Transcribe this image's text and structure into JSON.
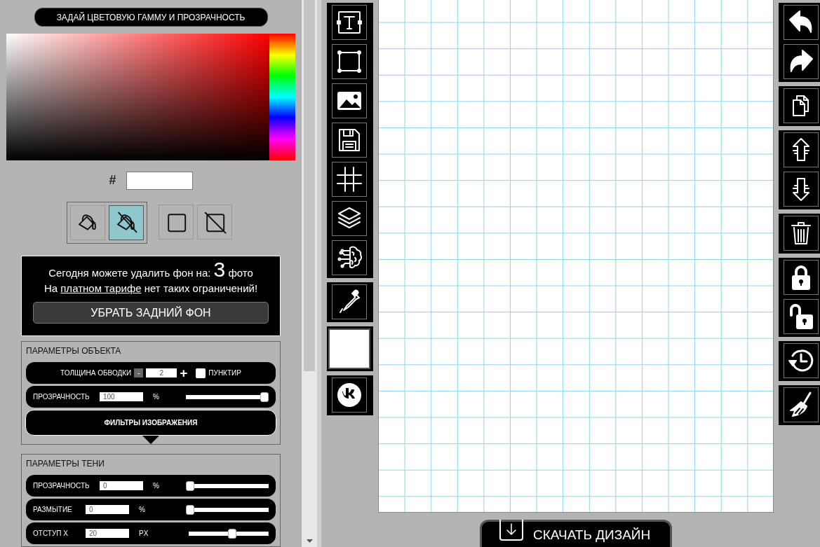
{
  "color_panel": {
    "title": "ЗАДАЙ ЦВЕТОВУЮ ГАММУ И ПРОЗРАЧНОСТЬ",
    "hex_label": "#",
    "fill_buttons": [
      {
        "kind": "fill",
        "selected": false
      },
      {
        "kind": "no-fill",
        "selected": true
      }
    ],
    "stroke_buttons": [
      {
        "kind": "stroke",
        "selected": false
      },
      {
        "kind": "no-stroke",
        "selected": false
      }
    ]
  },
  "promo": {
    "line1_before": "Сегодня можете удалить фон на:",
    "count": "3",
    "line1_after": "фото",
    "line2_before": "На",
    "link": "платном тарифе",
    "line2_after": "нет таких ограничений!",
    "button": "УБРАТЬ ЗАДНИЙ ФОН"
  },
  "object_params": {
    "title": "ПАРАМЕТРЫ ОБЪЕКТА",
    "stroke_label": "ТОЛЩИНА ОБВОДКИ",
    "minus": "-",
    "stroke_value": "2",
    "plus": "+",
    "dashed_label": "ПУНКТИР",
    "dashed_checked": false,
    "opacity": {
      "label": "ПРОЗРАЧНОСТЬ",
      "value": "100",
      "unit": "%",
      "level": 1
    },
    "filters_button": "ФИЛЬТРЫ ИЗОБРАЖЕНИЯ"
  },
  "shadow_params": {
    "title": "ПАРАМЕТРЫ ТЕНИ",
    "rows": [
      {
        "label": "ПРОЗРАЧНОСТЬ",
        "value": "0",
        "unit": "%",
        "level": 0
      },
      {
        "label": "РАЗМЫТИЕ",
        "value": "0",
        "unit": "%",
        "level": 0
      },
      {
        "label": "ОТСТУП X",
        "value": "20",
        "unit": "PX",
        "level": 0.55
      }
    ]
  },
  "download_button": "СКАЧАТЬ ДИЗАЙН"
}
